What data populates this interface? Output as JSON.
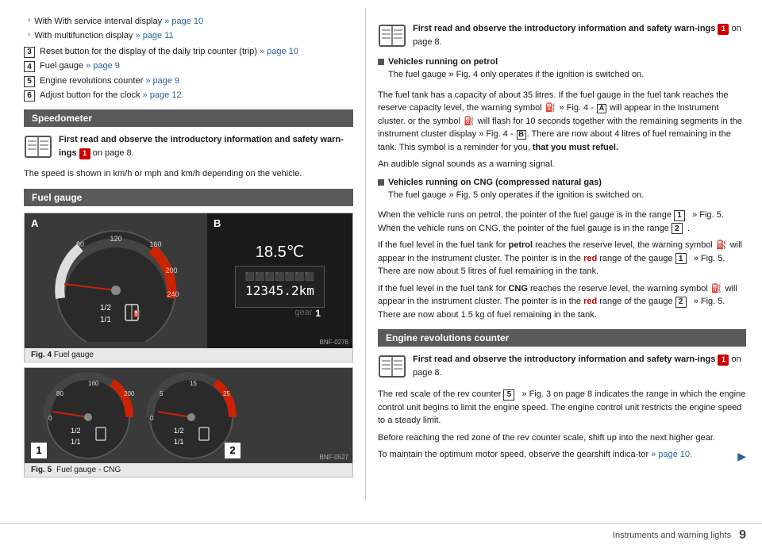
{
  "header": {
    "bullet_items": [
      {
        "text": "With service interval display ",
        "link": "» page 10",
        "link_page": 10
      },
      {
        "text": "With multifunction display ",
        "link": "» page 11",
        "link_page": 11
      }
    ],
    "numbered_items": [
      {
        "num": "3",
        "text": "Reset button for the display of the daily trip counter (trip) ",
        "link": "» page 10"
      },
      {
        "num": "4",
        "text": "Fuel gauge ",
        "link": "» page 9"
      },
      {
        "num": "5",
        "text": "Engine revolutions counter ",
        "link": "» page 9"
      },
      {
        "num": "6",
        "text": "Adjust button for the clock ",
        "link": "» page 12."
      }
    ]
  },
  "speedometer_section": {
    "header": "Speedometer",
    "info_text_bold": "First read and observe the introductory information and safety warn-ings ",
    "info_badge": "1",
    "info_suffix": " on page 8.",
    "speed_note": "The speed is shown in km/h or mph and km/h depending on the vehicle."
  },
  "fuel_gauge_section": {
    "header": "Fuel gauge",
    "fig4_label": "A",
    "fig4_label_b": "B",
    "fig4_id": "BNF-0276",
    "fig4_caption_bold": "Fig. 4",
    "fig4_caption": "  Fuel gauge",
    "fig5_id": "BNF-0527",
    "fig5_caption_bold": "Fig. 5",
    "fig5_caption": "\nFuel gauge - CNG",
    "cng_label_1": "1",
    "cng_label_2": "2",
    "temp_display": "18.5℃",
    "odo_display": "12345.2km",
    "gear_display": "1"
  },
  "right_column": {
    "info_text_bold": "First read and observe the introductory information and safety warn-ings ",
    "info_badge": "1",
    "info_suffix": " on page 8.",
    "petrol_heading": "Vehicles running on petrol",
    "petrol_line1": "The fuel gauge » Fig. 4 only operates if the ignition is switched on.",
    "petrol_para1": "The fuel tank has a capacity of about 35 litres. If the fuel gauge in the fuel tank reaches the reserve capacity level, the warning symbol",
    "petrol_para1_mid": " will appear in the Instrument cluster. or the symbol",
    "petrol_para1_mid2": " will flash for 10 seconds together with the remaining segments in the instrument cluster display » Fig. 4 -",
    "petrol_para1_b": "B",
    "petrol_para1_end": ". There are now about 4 litres of fuel remaining in the tank. This symbol is a reminder for you, that you must refuel.",
    "petrol_signal": "An audible signal sounds as a warning signal.",
    "cng_heading": "Vehicles running on CNG (compressed natural gas)",
    "cng_line1": "The fuel gauge » Fig. 5 only operates if the ignition is switched on.",
    "cng_para1": "When the vehicle runs on petrol, the pointer of the fuel gauge is in the range",
    "cng_para1_1": "1",
    "cng_para1_mid": " » Fig. 5. When the vehicle runs on CNG, the pointer of the fuel gauge is in the range",
    "cng_para1_2": "2",
    "cng_para1_end": ".",
    "petrol_reserve": "If the fuel level in the fuel tank for ",
    "petrol_reserve_bold": "petrol",
    "petrol_reserve_end": " reaches the reserve level, the warning symbol",
    "petrol_reserve_2": " will appear in the instrument cluster. The pointer is in the ",
    "petrol_reserve_red": "red",
    "petrol_reserve_3": " range of the gauge",
    "petrol_reserve_4": "1",
    "petrol_reserve_5": " » Fig. 5. There are now about 5 litres of fuel remaining in the tank.",
    "cng_reserve": "If the fuel level in the fuel tank for ",
    "cng_reserve_bold": "CNG",
    "cng_reserve_end": " reaches the reserve level, the warning symbol",
    "cng_reserve_2": " will appear in the instrument cluster. The pointer is in the ",
    "cng_reserve_red": "red",
    "cng_reserve_3": " range of the gauge",
    "cng_reserve_4": "2",
    "cng_reserve_5": " » Fig. 5. There are now about 1.5 kg of fuel remaining in the tank."
  },
  "engine_section": {
    "header": "Engine revolutions counter",
    "info_text_bold": "First read and observe the introductory information and safety warn-ings ",
    "info_badge": "1",
    "info_suffix": " on page 8.",
    "para1": "The red scale of the rev counter",
    "para1_5": "5",
    "para1_end": " » Fig. 3 on page 8 indicates the range in which the engine control unit begins to limit the engine speed. The engine control unit restricts the engine speed to a steady limit.",
    "para2": "Before reaching the red zone of the rev counter scale, shift up into the next higher gear.",
    "para3": "To maintain the optimum motor speed, observe the gearshift indicator » page 10.",
    "arrow_more": "▶"
  },
  "footer": {
    "label": "Instruments and warning lights",
    "page_number": "9"
  }
}
